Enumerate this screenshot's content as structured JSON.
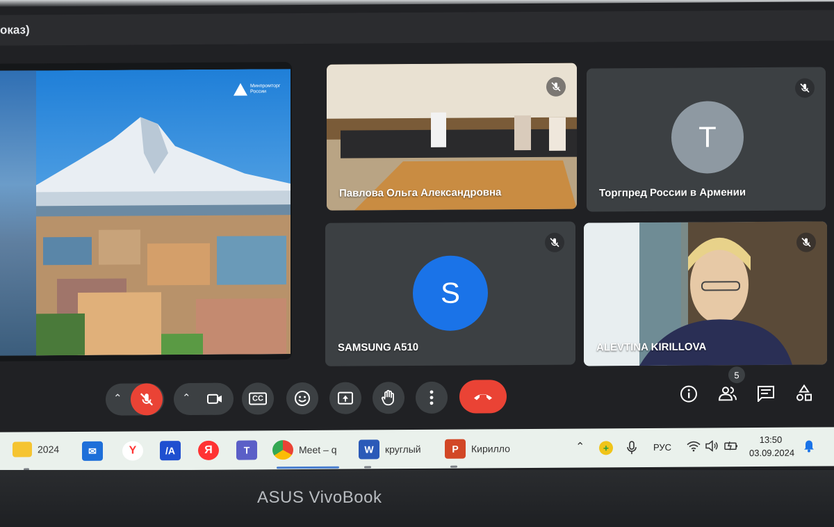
{
  "window": {
    "title": "оказ)"
  },
  "presentation": {
    "logo_text": "Минпромторг России"
  },
  "participants": [
    {
      "name": "Павлова Ольга Александровна",
      "muted": true
    },
    {
      "name": "Торгпред России в Армении",
      "initial": "T",
      "avatar_color": "#8e99a2",
      "muted": true
    },
    {
      "name": "SAMSUNG A510",
      "initial": "S",
      "avatar_color": "#1a73e8",
      "muted": true
    },
    {
      "name": "ALEVTINA KIRILLOVA",
      "muted": true
    }
  ],
  "controls": {
    "mic": "mic-off",
    "camera": "camera",
    "captions": "CC",
    "people_count": "5"
  },
  "taskbar": {
    "items": [
      {
        "icon": "folder-icon",
        "label": "2024"
      },
      {
        "icon": "mail-icon",
        "label": ""
      },
      {
        "icon": "yandex-browser-icon",
        "label": ""
      },
      {
        "icon": "app-ia-icon",
        "label": "/A"
      },
      {
        "icon": "yandex-icon",
        "label": "Я"
      },
      {
        "icon": "teams-icon",
        "label": ""
      },
      {
        "icon": "chrome-icon",
        "label": "Meet – q"
      },
      {
        "icon": "word-icon",
        "label": "круглый"
      },
      {
        "icon": "powerpoint-icon",
        "label": "Кирилло"
      }
    ],
    "language": "РУС",
    "time": "13:50",
    "date": "03.09.2024"
  },
  "laptop": {
    "brand": "ASUS VivoBook"
  },
  "colors": {
    "end_call": "#ea4335",
    "tile_bg": "#3c4043",
    "screen_bg": "#202124"
  }
}
